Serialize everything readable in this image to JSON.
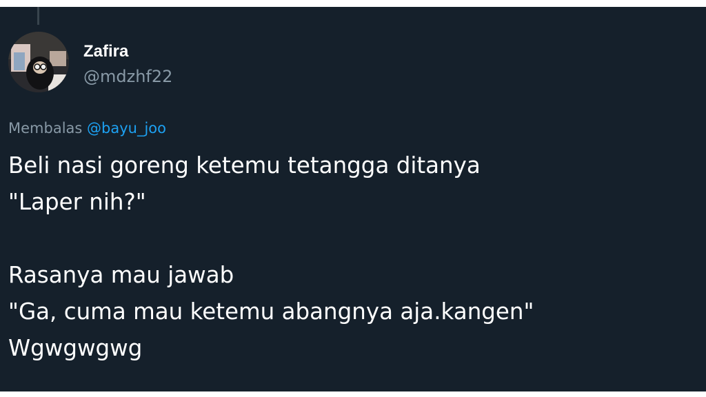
{
  "tweet": {
    "author": {
      "display_name": "Zafira",
      "handle": "@mdzhf22"
    },
    "reply_prefix": "Membalas",
    "reply_to": "@bayu_joo",
    "lines": [
      "Beli nasi goreng ketemu tetangga ditanya",
      "\"Laper nih?\"",
      "",
      "Rasanya mau jawab",
      "\"Ga, cuma mau ketemu abangnya aja.kangen\"",
      "Wgwgwgwg"
    ]
  },
  "colors": {
    "background": "#15202b",
    "text": "#ffffff",
    "secondary_text": "#8899a6",
    "link": "#1da1f2"
  },
  "icons": {
    "avatar": "profile-photo"
  }
}
